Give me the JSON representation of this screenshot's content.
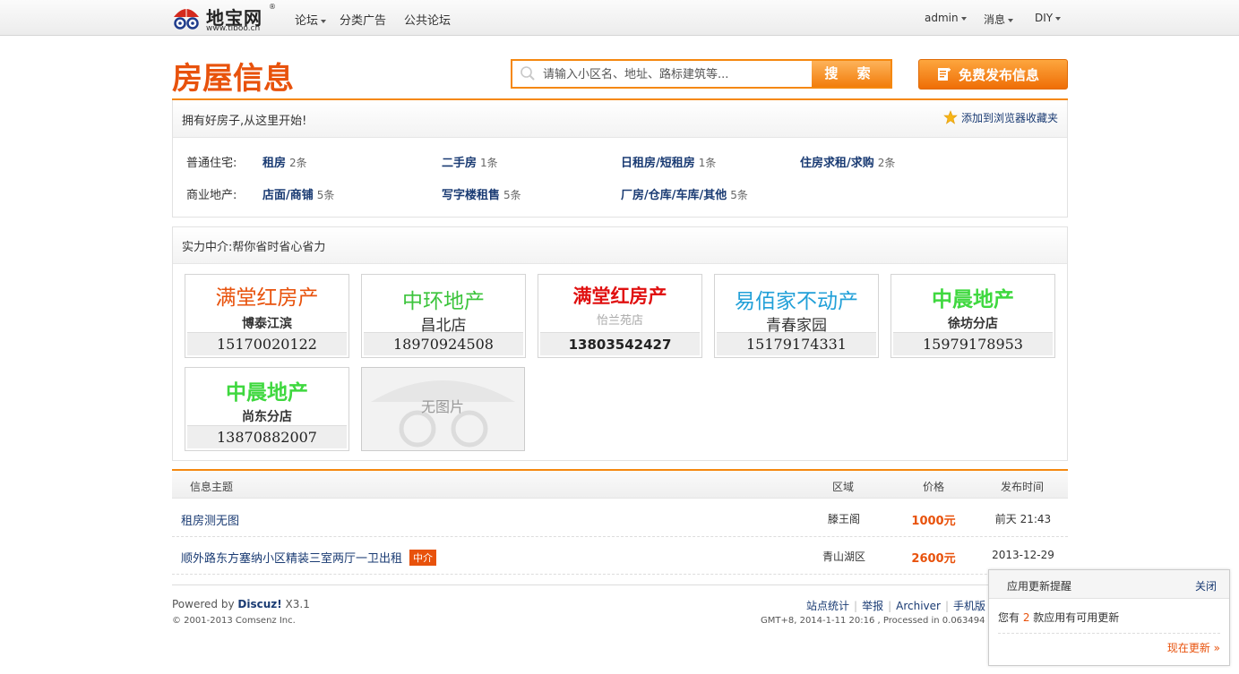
{
  "header": {
    "logo_text": "地宝网",
    "logo_reg": "®",
    "logo_url": "www.tiboo.cn",
    "nav": [
      {
        "label": "论坛",
        "has_menu": true
      },
      {
        "label": "分类广告",
        "has_menu": false
      },
      {
        "label": "公共论坛",
        "has_menu": false
      }
    ],
    "user_nav": [
      {
        "label": "admin"
      },
      {
        "label": "消息"
      },
      {
        "label": "DIY"
      }
    ]
  },
  "page": {
    "title": "房屋信息",
    "search_placeholder": "请输入小区名、地址、路标建筑等...",
    "search_button": "搜 索",
    "publish_button": "免费发布信息"
  },
  "categories": {
    "slogan": "拥有好房子,从这里开始!",
    "favorite_link": "添加到浏览器收藏夹",
    "groups": [
      {
        "label": "普通住宅:",
        "items": [
          {
            "name": "租房",
            "count": "2条"
          },
          {
            "name": "二手房",
            "count": "1条"
          },
          {
            "name": "日租房/短租房",
            "count": "1条"
          },
          {
            "name": "住房求租/求购",
            "count": "2条"
          }
        ]
      },
      {
        "label": "商业地产:",
        "items": [
          {
            "name": "店面/商铺",
            "count": "5条"
          },
          {
            "name": "写字楼租售",
            "count": "5条"
          },
          {
            "name": "厂房/仓库/车库/其他",
            "count": "5条"
          }
        ]
      }
    ]
  },
  "agents": {
    "title": "实力中介:帮你省时省心省力",
    "cards": [
      {
        "name": "满堂红房产",
        "sub": "博泰江滨",
        "phone": "15170020122",
        "color": "#e8520c"
      },
      {
        "name": "中环地产",
        "sub": "昌北店",
        "phone": "18970924508",
        "color": "#3cc43c"
      },
      {
        "name": "满堂红房产",
        "sub": "怡兰苑店",
        "phone": "13803542427",
        "color": "#e01010"
      },
      {
        "name": "易佰家不动产",
        "sub": "青春家园",
        "phone": "15179174331",
        "color": "#22a0d8"
      },
      {
        "name": "中晨地产",
        "sub": "徐坊分店",
        "phone": "15979178953",
        "color": "#3fd83f"
      },
      {
        "name": "中晨地产",
        "sub": "尚东分店",
        "phone": "13870882007",
        "color": "#3fd83f"
      }
    ],
    "no_image_text": "无图片"
  },
  "listing": {
    "headers": {
      "subject": "信息主题",
      "area": "区域",
      "price": "价格",
      "time": "发布时间"
    },
    "rows": [
      {
        "subject": "租房测无图",
        "tag": "",
        "area": "滕王阁",
        "price": "1000元",
        "time": "前天 21:43"
      },
      {
        "subject": "顺外路东方塞纳小区精装三室两厅一卫出租",
        "tag": "中介",
        "area": "青山湖区",
        "price": "2600元",
        "time": "2013-12-29"
      }
    ]
  },
  "footer": {
    "powered_prefix": "Powered by ",
    "powered_brand": "Discuz!",
    "powered_version": " X3.1",
    "copyright": "© 2001-2013 Comsenz Inc.",
    "links": [
      "站点统计",
      "举报",
      "Archiver",
      "手机版"
    ],
    "gmt": "GMT+8, 2014-1-11 20:16 , Processed in 0.063494 second(s)"
  },
  "popup": {
    "title": "应用更新提醒",
    "close": "关闭",
    "msg_prefix": "您有 ",
    "msg_count": "2",
    "msg_suffix": " 款应用有可用更新",
    "update_link": "现在更新 »"
  }
}
